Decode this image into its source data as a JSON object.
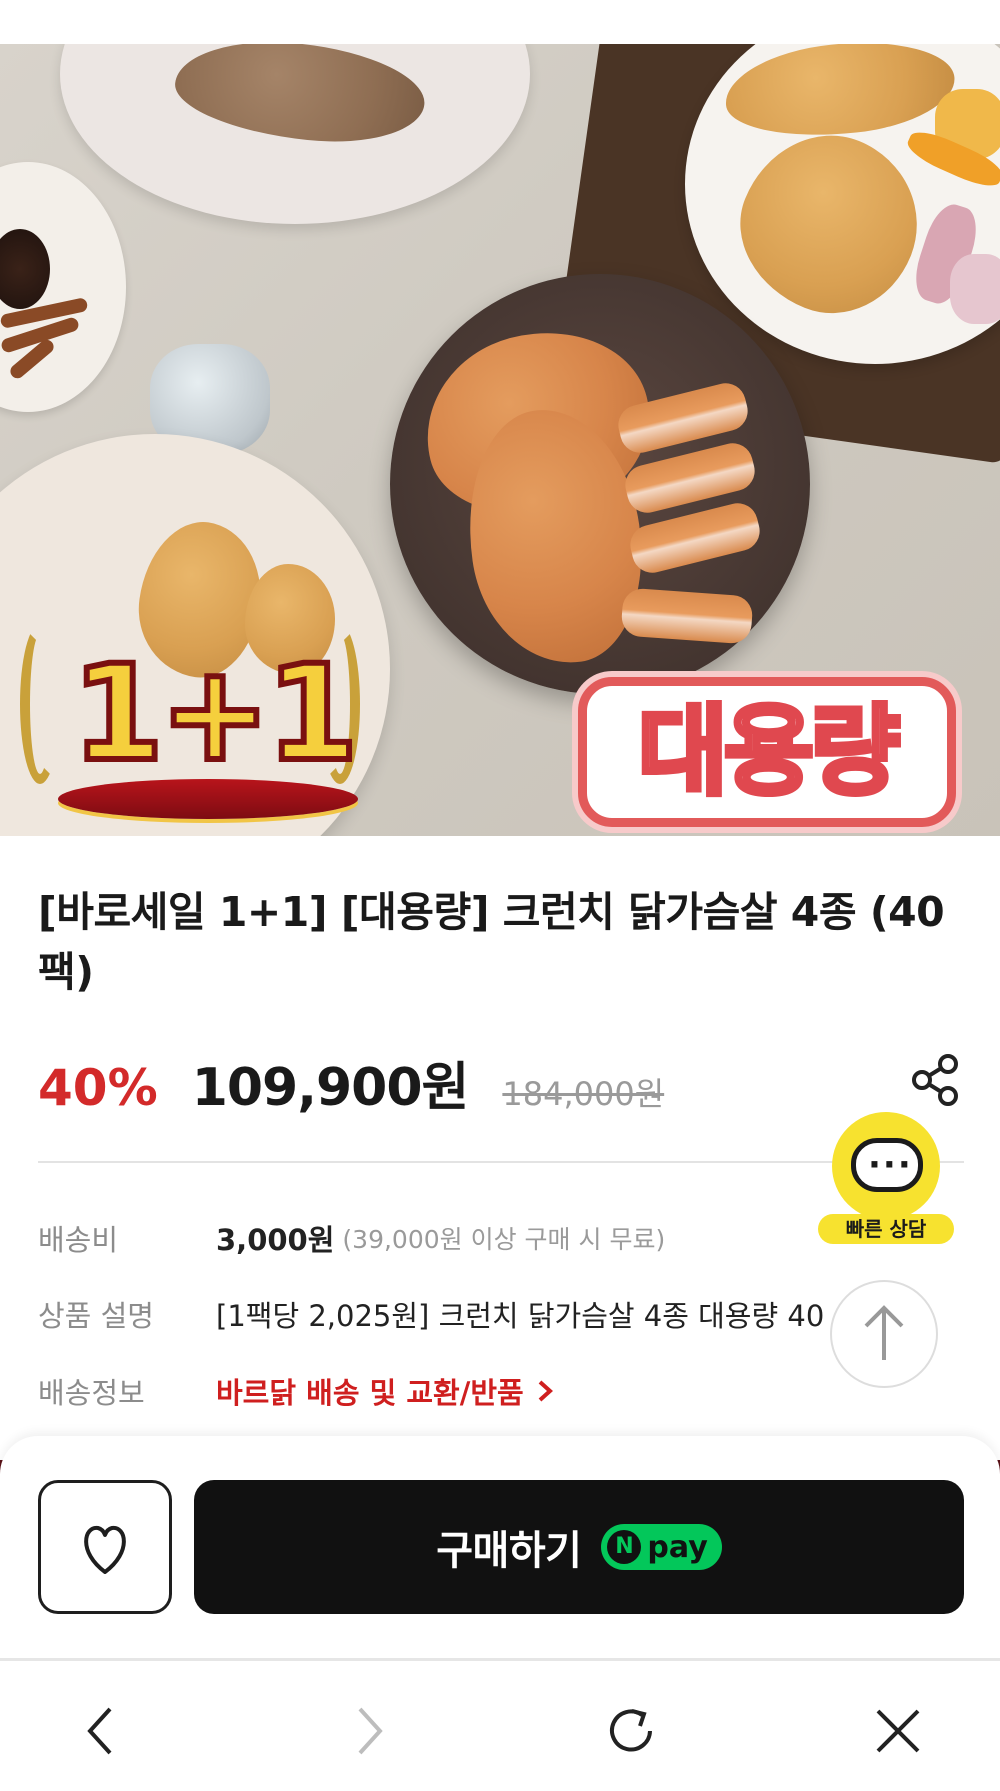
{
  "hero": {
    "badge_one_plus_one": "1+1",
    "badge_large_volume": "대용량"
  },
  "product": {
    "title": "[바로세일 1+1] [대용량] 크런치 닭가슴살 4종 (40팩)",
    "discount": "40%",
    "price": "109,900원",
    "original_price": "184,000원"
  },
  "info": {
    "shipping_fee_label": "배송비",
    "shipping_fee_value": "3,000원",
    "shipping_fee_note": "(39,000원 이상 구매 시 무료)",
    "description_label": "상품 설명",
    "description_value": "[1팩당 2,025원] 크런치 닭가슴살 4종 대용량 40",
    "delivery_label": "배송정보",
    "delivery_link": "바르닭 배송 및 교환/반품"
  },
  "chat": {
    "dots": "···",
    "label": "빠른 상담"
  },
  "purchase": {
    "buy_label": "구매하기",
    "npay_n": "N",
    "npay_text": "pay"
  },
  "icons": {
    "share": "share-icon",
    "heart": "heart-icon",
    "arrow_up": "arrow-up-icon",
    "back": "chevron-left-icon",
    "forward": "chevron-right-icon",
    "refresh": "refresh-icon",
    "close": "close-icon"
  },
  "colors": {
    "discount_red": "#d32a2a",
    "link_red": "#cf1f1f",
    "chat_yellow": "#f7e22f",
    "npay_green": "#03c75a",
    "buy_button": "#111111"
  }
}
